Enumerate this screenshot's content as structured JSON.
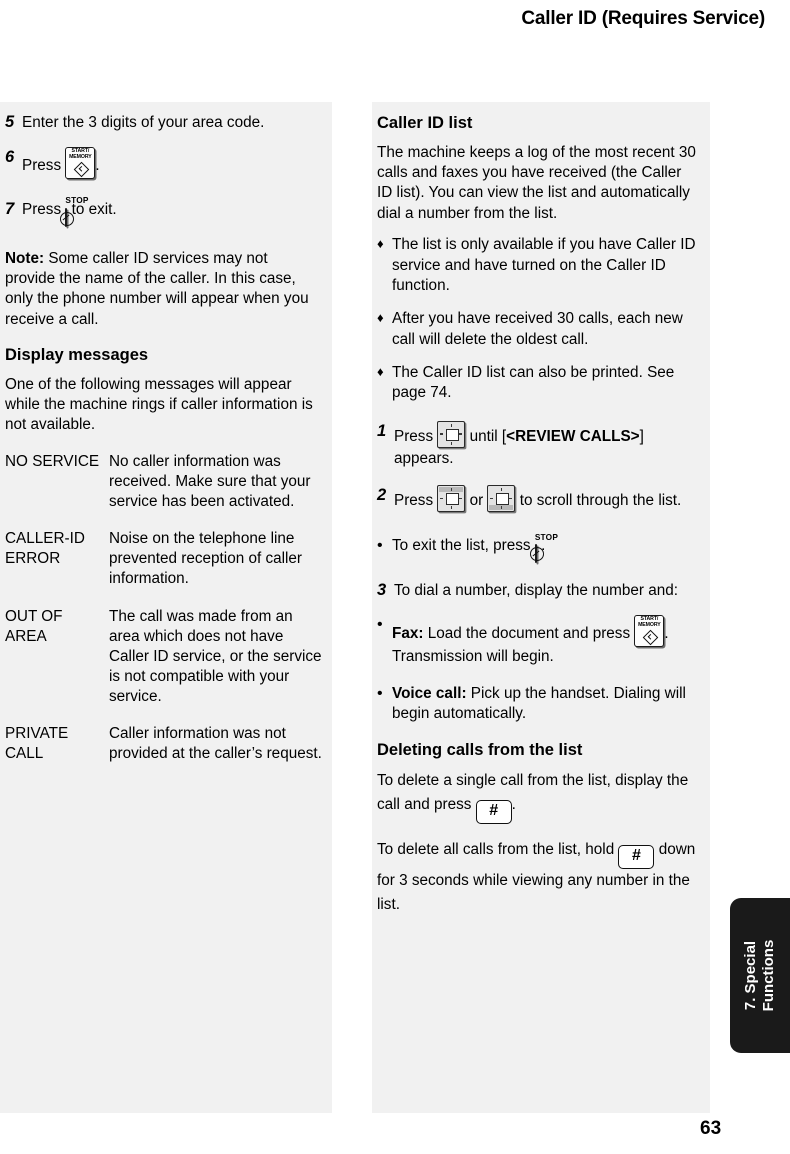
{
  "header": {
    "title": "Caller ID (Requires Service)"
  },
  "page_number": "63",
  "side_tab": {
    "label": "7. Special\nFunctions"
  },
  "left_column": {
    "step5": {
      "num": "5",
      "text": "Enter the 3 digits of your area code."
    },
    "step6": {
      "num": "6",
      "press_label": "Press",
      "key": "start-memory",
      "key_line1": "START/",
      "key_line2": "MEMORY",
      "trailing": "."
    },
    "step7": {
      "num": "7",
      "press_label": "Press",
      "key": "stop",
      "key_caption": "STOP",
      "trailing": "to exit."
    },
    "note": {
      "label": "Note:",
      "text": " Some caller ID services may not provide the name of the caller. In this case, only the phone number will appear when you receive a call."
    },
    "display_messages": {
      "heading": "Display messages",
      "intro": "One of the following messages will appear while the machine rings if caller information is not available.",
      "rows": [
        {
          "code": "NO SERVICE",
          "description": "No caller information was received. Make sure that your service has been activated."
        },
        {
          "code": "CALLER-ID ERROR",
          "description": "Noise on the telephone line prevented reception of caller information."
        },
        {
          "code": "OUT OF AREA",
          "description": "The call was made from an area which does not have Caller ID service, or the service is not compatible with your service."
        },
        {
          "code": "PRIVATE CALL",
          "description": "Caller information was not provided at the caller’s request."
        }
      ]
    }
  },
  "right_column": {
    "caller_id_list": {
      "heading": "Caller ID list",
      "intro": "The machine keeps a log of the most recent 30 calls and faxes you have received (the Caller ID list). You can view the list and automatically dial a number from the list.",
      "bullets": [
        "The list is only available if you have Caller ID service and have turned on the Caller ID function.",
        "After you have received 30 calls, each new call will delete the oldest call.",
        "The Caller ID list can also be printed. See page 74."
      ],
      "diamond_mark": "♦"
    },
    "step1": {
      "num": "1",
      "press_label": "Press",
      "key": "dpad",
      "after_key": "until [",
      "bold_token": "<REVIEW CALLS>",
      "after_token": "] appears."
    },
    "step2": {
      "num": "2",
      "press_label": "Press",
      "key_up": "dpad-up",
      "or_label": "or",
      "key_down": "dpad-down",
      "after": "to scroll through the list."
    },
    "exit_bullet": {
      "mark": "•",
      "text": "To exit the list, press",
      "key_caption": "STOP",
      "trailing": "."
    },
    "step3": {
      "num": "3",
      "text": "To dial a number, display the number and:"
    },
    "fax_bullet": {
      "mark": "•",
      "bold": "Fax:",
      "text": " Load the document and press",
      "key_line1": "START/",
      "key_line2": "MEMORY",
      "after_key": ". Transmission will begin."
    },
    "voice_bullet": {
      "mark": "•",
      "bold": "Voice call:",
      "text": " Pick up the handset. Dialing will begin automatically."
    },
    "deleting": {
      "heading": "Deleting calls from the list",
      "para1_before": "To delete a single call from the list, display the call and press",
      "hash_key": "#",
      "para1_after": ".",
      "para2_before": "To delete all calls from the list, hold",
      "para2_after": "down for 3 seconds while viewing any number in the list."
    }
  }
}
